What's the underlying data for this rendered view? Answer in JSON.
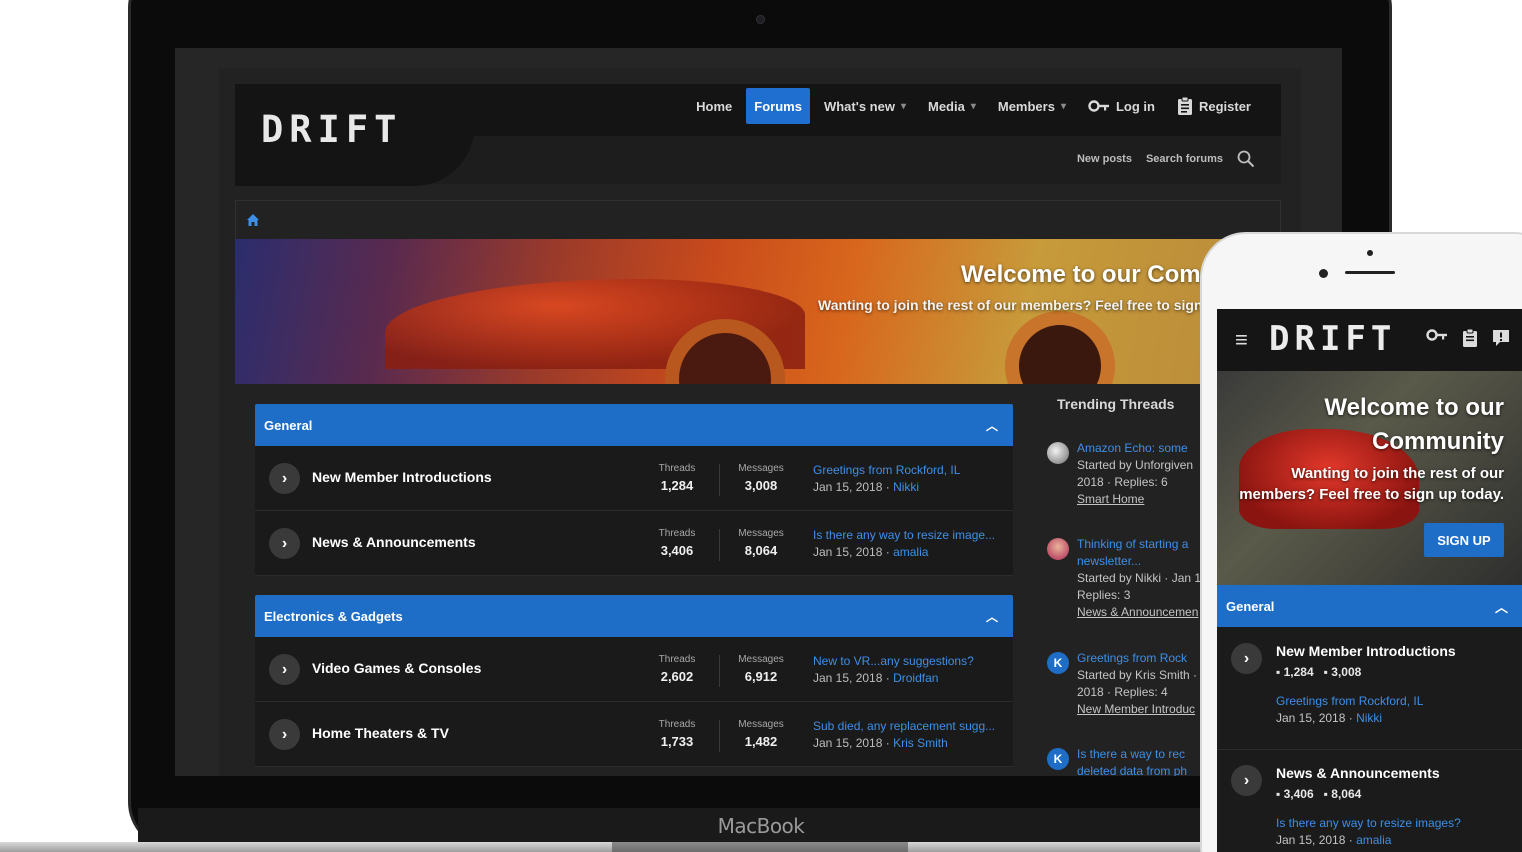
{
  "device_label": "MacBook",
  "desktop": {
    "logo": "DRIFT",
    "nav": {
      "home": "Home",
      "forums": "Forums",
      "whats_new": "What's new",
      "media": "Media",
      "members": "Members",
      "login": "Log in",
      "register": "Register"
    },
    "subnav": {
      "new_posts": "New posts",
      "search_forums": "Search forums"
    },
    "banner": {
      "title": "Welcome to our Comm",
      "subtitle": "Wanting to join the rest of our members? Feel free to sign"
    },
    "categories": [
      {
        "title": "General",
        "nodes": [
          {
            "title": "New Member Introductions",
            "threads_label": "Threads",
            "threads": "1,284",
            "messages_label": "Messages",
            "messages": "3,008",
            "latest_title": "Greetings from Rockford, IL",
            "latest_date": "Jan 15, 2018 · ",
            "latest_user": "Nikki"
          },
          {
            "title": "News & Announcements",
            "threads_label": "Threads",
            "threads": "3,406",
            "messages_label": "Messages",
            "messages": "8,064",
            "latest_title": "Is there any way to resize image...",
            "latest_date": "Jan 15, 2018 · ",
            "latest_user": "amalia"
          }
        ]
      },
      {
        "title": "Electronics & Gadgets",
        "nodes": [
          {
            "title": "Video Games & Consoles",
            "threads_label": "Threads",
            "threads": "2,602",
            "messages_label": "Messages",
            "messages": "6,912",
            "latest_title": "New to VR...any suggestions?",
            "latest_date": "Jan 15, 2018 · ",
            "latest_user": "Droidfan"
          },
          {
            "title": "Home Theaters & TV",
            "threads_label": "Threads",
            "threads": "1,733",
            "messages_label": "Messages",
            "messages": "1,482",
            "latest_title": "Sub died, any replacement sugg...",
            "latest_date": "Jan 15, 2018 · ",
            "latest_user": "Kris Smith"
          }
        ]
      }
    ],
    "sidebar": {
      "title": "Trending Threads",
      "items": [
        {
          "title": "Amazon Echo: some",
          "meta1": "Started by Unforgiven",
          "meta2": "2018 · Replies: 6",
          "forum": "Smart Home"
        },
        {
          "title": "Thinking of starting a newsletter...",
          "meta1": "Started by Nikki · Jan 1",
          "meta2": "Replies: 3",
          "forum": "News & Announcemen"
        },
        {
          "title": "Greetings from Rock",
          "meta1": "Started by Kris Smith ·",
          "meta2": "2018 · Replies: 4",
          "forum": "New Member Introduc"
        },
        {
          "title": "Is there a way to rec deleted data from ph",
          "avatar_letter": "K"
        }
      ],
      "avatar_letters": [
        "K",
        "K"
      ]
    }
  },
  "mobile": {
    "logo": "DRIFT",
    "banner": {
      "title": "Welcome to our Community",
      "subtitle": "Wanting to join the rest of our members? Feel free to sign up today.",
      "signup": "SIGN UP"
    },
    "category": "General",
    "nodes": [
      {
        "title": "New Member Introductions",
        "threads": "1,284",
        "messages": "3,008",
        "latest_title": "Greetings from Rockford, IL",
        "latest_date": "Jan 15, 2018 · ",
        "latest_user": "Nikki"
      },
      {
        "title": "News & Announcements",
        "threads": "3,406",
        "messages": "8,064",
        "latest_title": "Is there any way to resize images?",
        "latest_date": "Jan 15, 2018 · ",
        "latest_user": "amalia"
      }
    ]
  },
  "colors": {
    "accent": "#1e6ec8",
    "link": "#3d8fe8",
    "background": "#222222"
  }
}
